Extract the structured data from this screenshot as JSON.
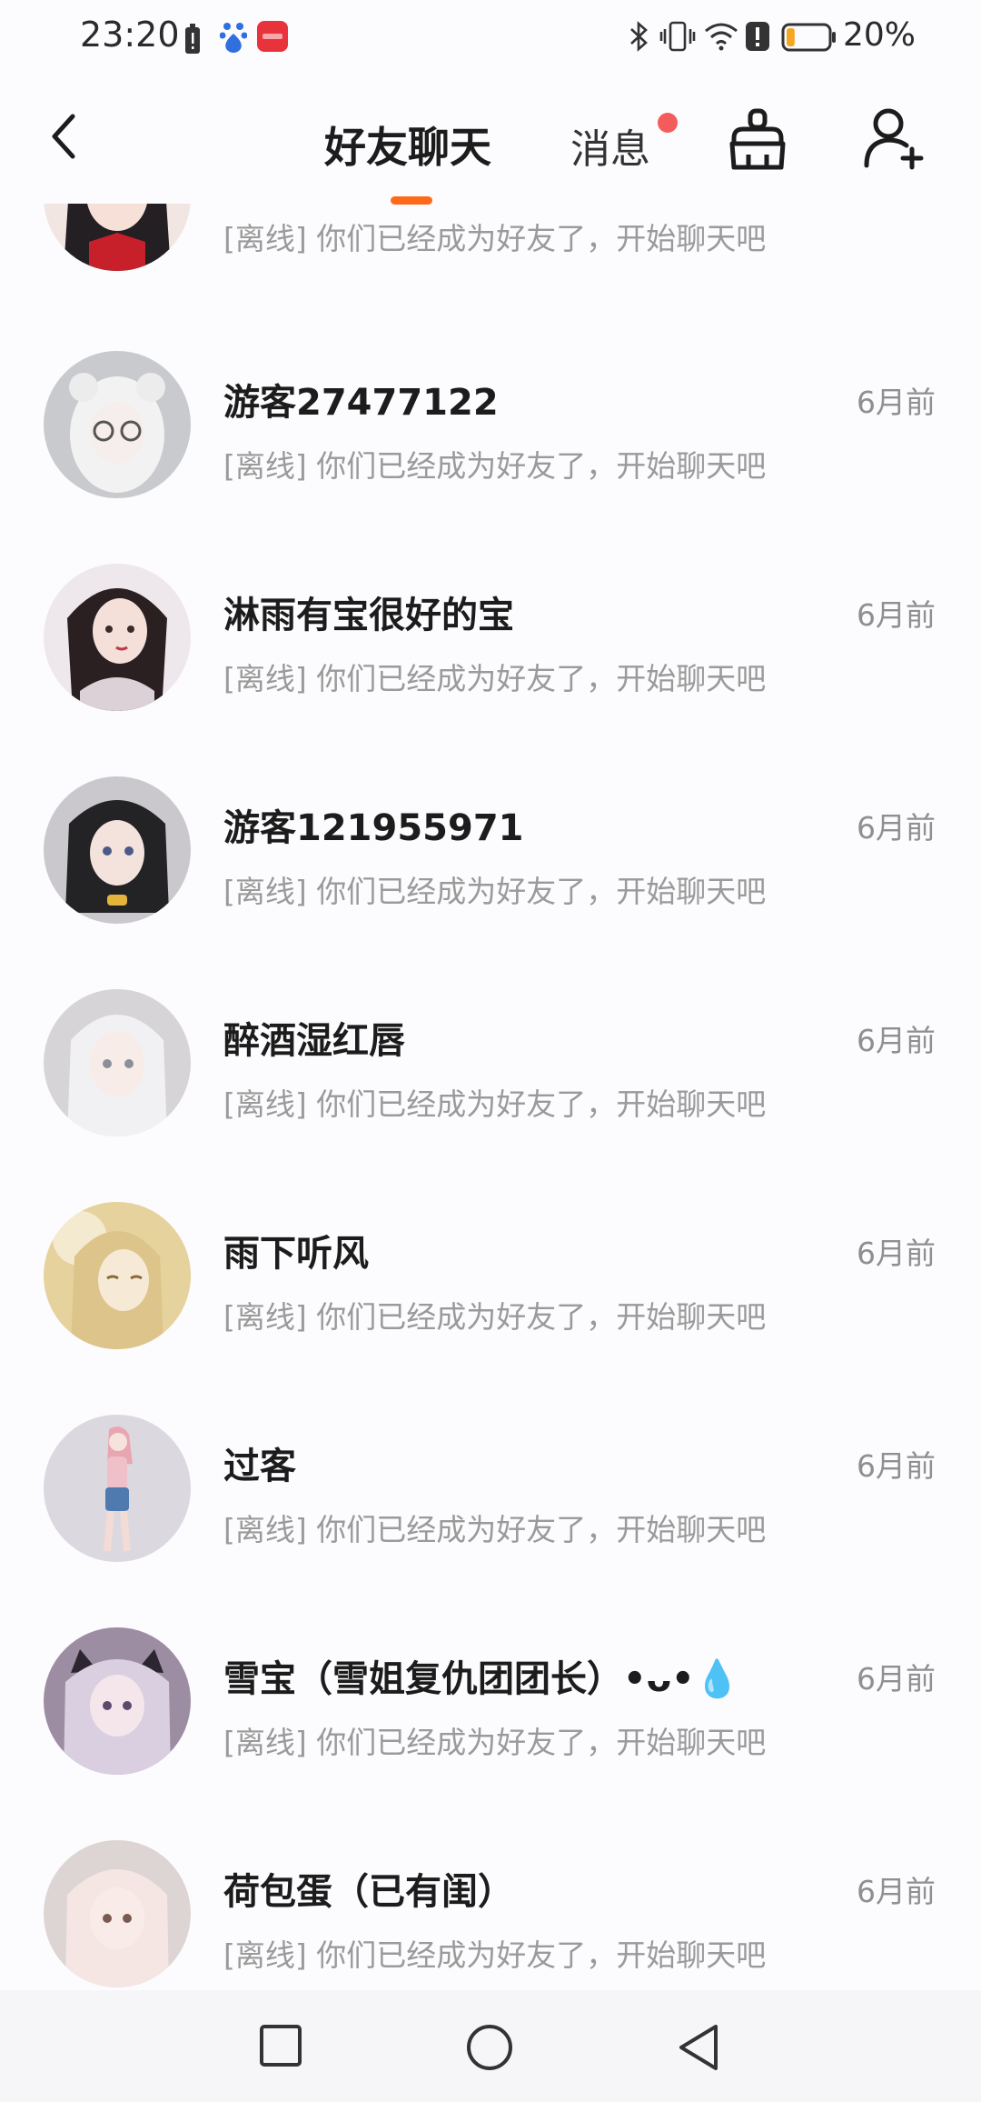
{
  "status_bar": {
    "time": "23:20",
    "battery_percent": "20%",
    "battery_level": 0.2,
    "icons": [
      "battery-alert-icon",
      "baidu-icon",
      "huawei-app-icon",
      "bluetooth-icon",
      "vibrate-icon",
      "wifi-icon",
      "alert-icon",
      "battery-icon"
    ]
  },
  "header": {
    "back_icon": "back-arrow-icon",
    "title": "好友聊天",
    "messages_tab": "消息",
    "messages_has_badge": true,
    "clean_icon": "broom-icon",
    "add_friend_icon": "add-user-icon",
    "accent_color": "#ff6a1a",
    "badge_color": "#f45c5c"
  },
  "chats": [
    {
      "name": "",
      "time": "",
      "preview": "[离线] 你们已经成为好友了，开始聊天吧",
      "avatar_color": "#e8d3cf"
    },
    {
      "name": "游客27477122",
      "time": "6月前",
      "preview": "[离线] 你们已经成为好友了，开始聊天吧",
      "avatar_color": "#cfd0d4"
    },
    {
      "name": "淋雨有宝很好的宝",
      "time": "6月前",
      "preview": "[离线] 你们已经成为好友了，开始聊天吧",
      "avatar_color": "#e9e2e6"
    },
    {
      "name": "游客121955971",
      "time": "6月前",
      "preview": "[离线] 你们已经成为好友了，开始聊天吧",
      "avatar_color": "#c9c7cb"
    },
    {
      "name": "醉酒湿红唇",
      "time": "6月前",
      "preview": "[离线] 你们已经成为好友了，开始聊天吧",
      "avatar_color": "#d8d6d8"
    },
    {
      "name": "雨下听风",
      "time": "6月前",
      "preview": "[离线] 你们已经成为好友了，开始聊天吧",
      "avatar_color": "#e7d49a"
    },
    {
      "name": "过客",
      "time": "6月前",
      "preview": "[离线] 你们已经成为好友了，开始聊天吧",
      "avatar_color": "#d9d6de"
    },
    {
      "name": "雪宝（雪姐复仇团团长）•ᴗ•💧",
      "time": "6月前",
      "preview": "[离线] 你们已经成为好友了，开始聊天吧",
      "avatar_color": "#a99aab"
    },
    {
      "name": "荷包蛋（已有闺）",
      "time": "6月前",
      "preview": "[离线] 你们已经成为好友了，开始聊天吧",
      "avatar_color": "#e6d6d4"
    }
  ],
  "nav_bar": {
    "icons": [
      "recent-apps-icon",
      "home-icon",
      "back-triangle-icon"
    ]
  }
}
